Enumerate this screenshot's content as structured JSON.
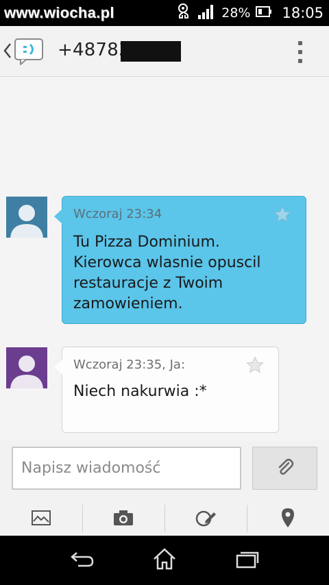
{
  "status_bar": {
    "watermark": "www.wiocha.pl",
    "battery_percent": "28%",
    "time": "18:05",
    "icons": [
      "headset-icon",
      "signal-icon",
      "battery-icon"
    ]
  },
  "header": {
    "contact_number": "+487838",
    "back_icon": "chevron-left-icon",
    "app_icon": "messaging-icon",
    "menu_icon": "overflow-menu-icon"
  },
  "messages": [
    {
      "direction": "incoming",
      "timestamp": "Wczoraj 23:34",
      "text": "Tu Pizza Dominium. Kierowca wlasnie opuscil restauracje z Twoim zamowieniem.",
      "bubble_color": "#5bc5ea",
      "avatar_color": "#3f7fa3"
    },
    {
      "direction": "outgoing",
      "timestamp": "Wczoraj 23:35, Ja:",
      "text": "Niech nakurwia :*",
      "bubble_color": "#fdfdfd",
      "avatar_color": "#6b3d8e"
    }
  ],
  "compose": {
    "placeholder": "Napisz wiadomość",
    "attach_icon": "paperclip-icon"
  },
  "attachment_bar": [
    "image-icon",
    "camera-icon",
    "sketch-icon",
    "location-pin-icon"
  ],
  "nav_bar": [
    "back-icon",
    "home-icon",
    "recent-apps-icon"
  ]
}
